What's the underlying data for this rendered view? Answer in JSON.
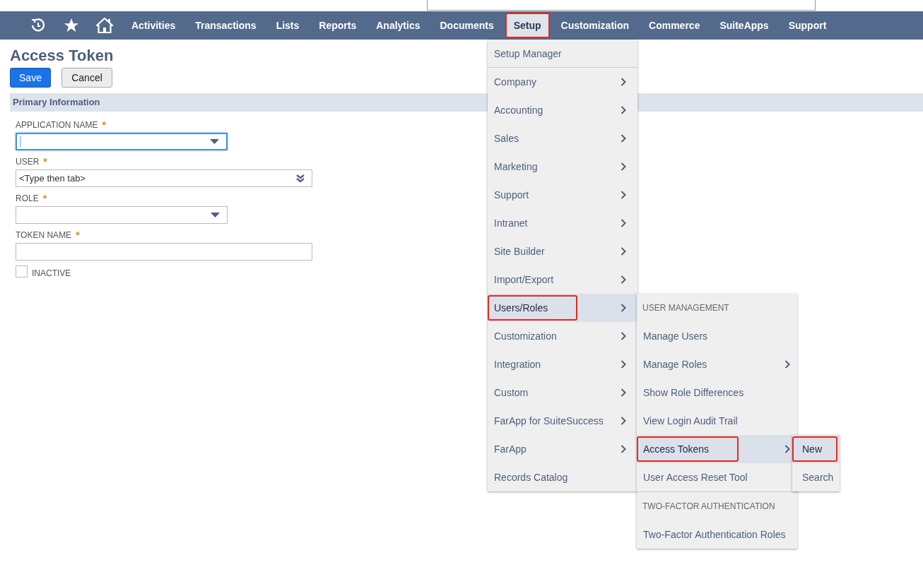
{
  "nav": {
    "items": [
      {
        "label": "Activities",
        "selected": false,
        "annotated": false
      },
      {
        "label": "Transactions",
        "selected": false,
        "annotated": false
      },
      {
        "label": "Lists",
        "selected": false,
        "annotated": false
      },
      {
        "label": "Reports",
        "selected": false,
        "annotated": false
      },
      {
        "label": "Analytics",
        "selected": false,
        "annotated": false
      },
      {
        "label": "Documents",
        "selected": false,
        "annotated": false
      },
      {
        "label": "Setup",
        "selected": true,
        "annotated": true
      },
      {
        "label": "Customization",
        "selected": false,
        "annotated": false
      },
      {
        "label": "Commerce",
        "selected": false,
        "annotated": false
      },
      {
        "label": "SuiteApps",
        "selected": false,
        "annotated": false
      },
      {
        "label": "Support",
        "selected": false,
        "annotated": false
      }
    ]
  },
  "page": {
    "title": "Access Token",
    "buttons": [
      {
        "label": "Save",
        "kind": "primary"
      },
      {
        "label": "Cancel",
        "kind": "secondary"
      }
    ],
    "section": "Primary Information",
    "fields": [
      {
        "label": "APPLICATION NAME",
        "required": "*",
        "kind": "select",
        "focused": true,
        "wide": false
      },
      {
        "label": "USER",
        "required": "*",
        "kind": "autocomplete",
        "placeholder": "<Type then tab>",
        "focused": false,
        "wide": true
      },
      {
        "label": "ROLE",
        "required": "*",
        "kind": "select",
        "focused": false,
        "wide": false
      },
      {
        "label": "TOKEN NAME",
        "required": "*",
        "kind": "text",
        "focused": false,
        "wide": true
      }
    ],
    "checkbox": {
      "label": "INACTIVE",
      "checked": false
    }
  },
  "menu": {
    "items": [
      {
        "label": "Setup Manager",
        "submenu": false,
        "selected": false,
        "annotated": false
      },
      {
        "label": "Company",
        "submenu": true,
        "selected": false,
        "annotated": false
      },
      {
        "label": "Accounting",
        "submenu": true,
        "selected": false,
        "annotated": false
      },
      {
        "label": "Sales",
        "submenu": true,
        "selected": false,
        "annotated": false
      },
      {
        "label": "Marketing",
        "submenu": true,
        "selected": false,
        "annotated": false
      },
      {
        "label": "Support",
        "submenu": true,
        "selected": false,
        "annotated": false
      },
      {
        "label": "Intranet",
        "submenu": true,
        "selected": false,
        "annotated": false
      },
      {
        "label": "Site Builder",
        "submenu": true,
        "selected": false,
        "annotated": false
      },
      {
        "label": "Import/Export",
        "submenu": true,
        "selected": false,
        "annotated": false
      },
      {
        "label": "Users/Roles",
        "submenu": true,
        "selected": true,
        "annotated": true
      },
      {
        "label": "Customization",
        "submenu": true,
        "selected": false,
        "annotated": false
      },
      {
        "label": "Integration",
        "submenu": true,
        "selected": false,
        "annotated": false
      },
      {
        "label": "Custom",
        "submenu": true,
        "selected": false,
        "annotated": false
      },
      {
        "label": "FarApp for SuiteSuccess",
        "submenu": true,
        "selected": false,
        "annotated": false
      },
      {
        "label": "FarApp",
        "submenu": true,
        "selected": false,
        "annotated": false
      },
      {
        "label": "Records Catalog",
        "submenu": false,
        "selected": false,
        "annotated": false
      }
    ]
  },
  "submenu": {
    "items": [
      {
        "kind": "heading",
        "label": "USER MANAGEMENT"
      },
      {
        "kind": "item",
        "label": "Manage Users",
        "submenu": false,
        "selected": false,
        "annotated": false
      },
      {
        "kind": "item",
        "label": "Manage Roles",
        "submenu": true,
        "selected": false,
        "annotated": false
      },
      {
        "kind": "item",
        "label": "Show Role Differences",
        "submenu": false,
        "selected": false,
        "annotated": false
      },
      {
        "kind": "item",
        "label": "View Login Audit Trail",
        "submenu": false,
        "selected": false,
        "annotated": false
      },
      {
        "kind": "item",
        "label": "Access Tokens",
        "submenu": true,
        "selected": true,
        "annotated": true
      },
      {
        "kind": "item",
        "label": "User Access Reset Tool",
        "submenu": false,
        "selected": false,
        "annotated": false
      },
      {
        "kind": "heading",
        "label": "TWO-FACTOR AUTHENTICATION"
      },
      {
        "kind": "item",
        "label": "Two-Factor Authentication Roles",
        "submenu": false,
        "selected": false,
        "annotated": false
      }
    ]
  },
  "submenu2": {
    "items": [
      {
        "label": "New",
        "selected": true,
        "annotated": true
      },
      {
        "label": "Search",
        "selected": false,
        "annotated": false
      }
    ]
  }
}
